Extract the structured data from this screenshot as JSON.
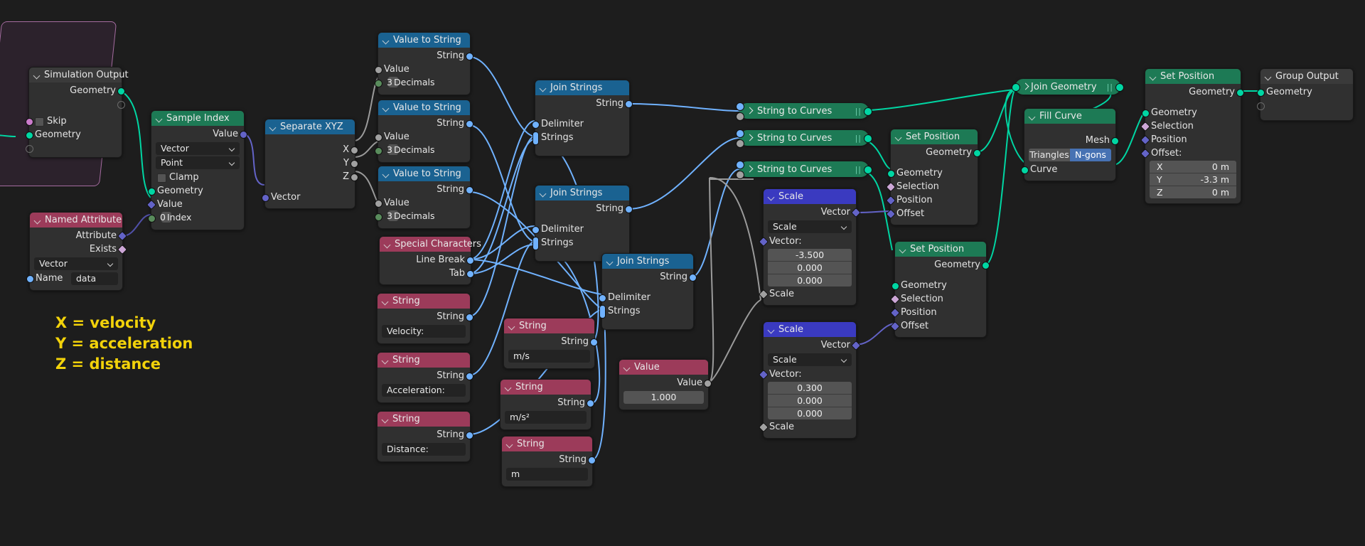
{
  "annotation": {
    "lines": "X = velocity\nY = acceleration\nZ = distance",
    "color": "#f2d20a"
  },
  "palette": {
    "background": "#1d1d1d",
    "geometry_header": "#1d7a55",
    "vector_header": "#3a3ac0",
    "input_header": "#1a6291",
    "text_header": "#9c3b5a",
    "io_header": "#3a3a3a",
    "geometry_socket": "#00d6a3",
    "string_socket": "#70b2ff",
    "vector_socket": "#6363c7",
    "value_socket": "#a1a1a1",
    "sim_zone_border": "#a56ca0",
    "toggle_active": "#4772b3"
  },
  "nodes": {
    "simulation_output": {
      "title": "Simulation Output",
      "out_geometry": "Geometry",
      "in_skip": "Skip",
      "in_geometry": "Geometry"
    },
    "named_attribute": {
      "title": "Named Attribute",
      "out_attribute": "Attribute",
      "out_exists": "Exists",
      "data_type": "Vector",
      "in_name_label": "Name",
      "name_value": "data"
    },
    "sample_index": {
      "title": "Sample Index",
      "out_value": "Value",
      "data_type": "Vector",
      "domain": "Point",
      "clamp": "Clamp",
      "in_geometry": "Geometry",
      "in_value": "Value",
      "in_index_label": "Index",
      "index_value": "0"
    },
    "separate_xyz": {
      "title": "Separate XYZ",
      "out_x": "X",
      "out_y": "Y",
      "out_z": "Z",
      "in_vector": "Vector"
    },
    "value_to_string_1": {
      "title": "Value to String",
      "out_string": "String",
      "in_value": "Value",
      "decimals_label": "Decimals",
      "decimals_value": "3"
    },
    "value_to_string_2": {
      "title": "Value to String",
      "out_string": "String",
      "in_value": "Value",
      "decimals_label": "Decimals",
      "decimals_value": "3"
    },
    "value_to_string_3": {
      "title": "Value to String",
      "out_string": "String",
      "in_value": "Value",
      "decimals_label": "Decimals",
      "decimals_value": "3"
    },
    "special_characters": {
      "title": "Special Characters",
      "out_line_break": "Line Break",
      "out_tab": "Tab"
    },
    "string_velocity": {
      "title": "String",
      "out_string": "String",
      "value": "Velocity:"
    },
    "string_acceleration": {
      "title": "String",
      "out_string": "String",
      "value": "Acceleration:"
    },
    "string_distance": {
      "title": "String",
      "out_string": "String",
      "value": "Distance:"
    },
    "string_ms": {
      "title": "String",
      "out_string": "String",
      "value": "m/s"
    },
    "string_ms2": {
      "title": "String",
      "out_string": "String",
      "value": "m/s²"
    },
    "string_m": {
      "title": "String",
      "out_string": "String",
      "value": "m"
    },
    "join_strings_1": {
      "title": "Join Strings",
      "out_string": "String",
      "in_delimiter": "Delimiter",
      "in_strings": "Strings"
    },
    "join_strings_2": {
      "title": "Join Strings",
      "out_string": "String",
      "in_delimiter": "Delimiter",
      "in_strings": "Strings"
    },
    "join_strings_3": {
      "title": "Join Strings",
      "out_string": "String",
      "in_delimiter": "Delimiter",
      "in_strings": "Strings"
    },
    "value_node": {
      "title": "Value",
      "out_value": "Value",
      "value": "1.000"
    },
    "string_to_curves_1": {
      "title": "String to Curves"
    },
    "string_to_curves_2": {
      "title": "String to Curves"
    },
    "string_to_curves_3": {
      "title": "String to Curves"
    },
    "scale_1": {
      "title": "Scale",
      "out_vector": "Vector",
      "operation": "Scale",
      "vector_label": "Vector:",
      "vector": [
        "-3.500",
        "0.000",
        "0.000"
      ],
      "in_scale": "Scale"
    },
    "scale_2": {
      "title": "Scale",
      "out_vector": "Vector",
      "operation": "Scale",
      "vector_label": "Vector:",
      "vector": [
        "0.300",
        "0.000",
        "0.000"
      ],
      "in_scale": "Scale"
    },
    "set_position_1": {
      "title": "Set Position",
      "out_geometry": "Geometry",
      "in_geometry": "Geometry",
      "in_selection": "Selection",
      "in_position": "Position",
      "in_offset": "Offset"
    },
    "set_position_2": {
      "title": "Set Position",
      "out_geometry": "Geometry",
      "in_geometry": "Geometry",
      "in_selection": "Selection",
      "in_position": "Position",
      "in_offset": "Offset"
    },
    "set_position_3": {
      "title": "Set Position",
      "out_geometry": "Geometry",
      "in_geometry": "Geometry",
      "in_selection": "Selection",
      "in_position": "Position",
      "in_offset_label": "Offset:",
      "offset": [
        {
          "axis": "X",
          "value": "0 m"
        },
        {
          "axis": "Y",
          "value": "-3.3 m"
        },
        {
          "axis": "Z",
          "value": "0 m"
        }
      ]
    },
    "join_geometry": {
      "title": "Join Geometry"
    },
    "fill_curve": {
      "title": "Fill Curve",
      "out_mesh": "Mesh",
      "mode_triangles": "Triangles",
      "mode_ngons": "N-gons",
      "mode_selected": "N-gons",
      "in_curve": "Curve"
    },
    "group_output": {
      "title": "Group Output",
      "in_geometry": "Geometry"
    }
  }
}
